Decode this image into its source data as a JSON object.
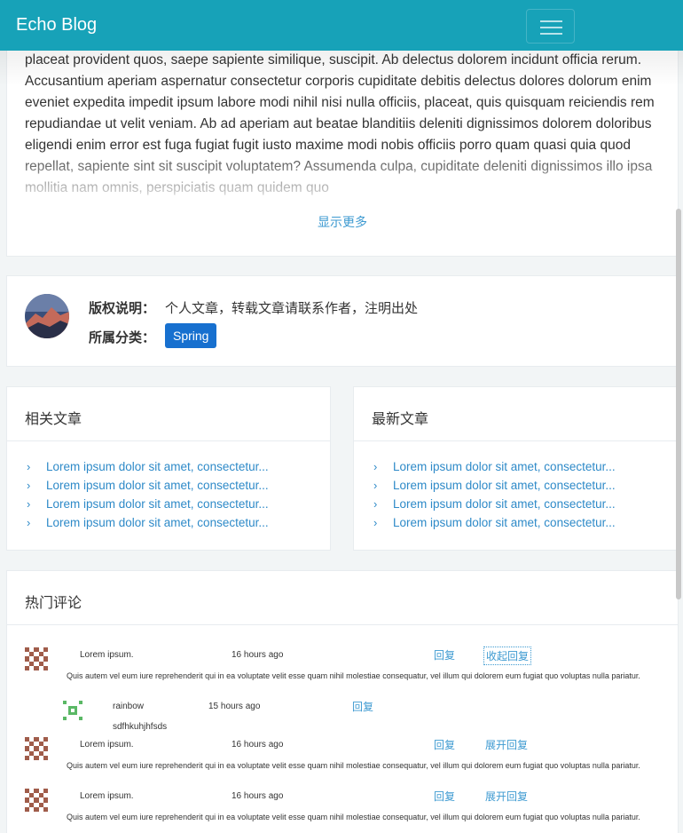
{
  "navbar": {
    "brand": "Echo Blog"
  },
  "article": {
    "text": "placeat provident quos, saepe sapiente similique, suscipit. Ab delectus dolorem incidunt officia rerum. Accusantium aperiam aspernatur consectetur corporis cupiditate debitis delectus dolores dolorum enim eveniet expedita impedit ipsum labore modi nihil nisi nulla officiis, placeat, quis quisquam reiciendis rem repudiandae ut velit veniam. Ab ad aperiam aut beatae blanditiis deleniti dignissimos dolorem doloribus eligendi enim error est fuga fugiat fugit iusto maxime modi nobis officiis porro quam quasi quia quod repellat, sapiente sint sit suscipit voluptatem? Assumenda culpa, cupiditate deleniti dignissimos illo ipsa mollitia nam omnis, perspiciatis quam quidem quo",
    "show_more": "显示更多"
  },
  "copyright": {
    "label": "版权说明：",
    "value": "个人文章，转载文章请联系作者，注明出处",
    "category_label": "所属分类：",
    "category": "Spring"
  },
  "related": {
    "title": "相关文章",
    "items": [
      "Lorem ipsum dolor sit amet, consectetur...",
      "Lorem ipsum dolor sit amet, consectetur...",
      "Lorem ipsum dolor sit amet, consectetur...",
      "Lorem ipsum dolor sit amet, consectetur..."
    ]
  },
  "latest": {
    "title": "最新文章",
    "items": [
      "Lorem ipsum dolor sit amet, consectetur...",
      "Lorem ipsum dolor sit amet, consectetur...",
      "Lorem ipsum dolor sit amet, consectetur...",
      "Lorem ipsum dolor sit amet, consectetur..."
    ]
  },
  "comments": {
    "title": "热门评论",
    "items": [
      {
        "user": "Lorem ipsum.",
        "time": "16 hours ago",
        "reply": "回复",
        "toggle": "收起回复",
        "body": "Quis autem vel eum iure reprehenderit qui in ea voluptate velit esse quam nihil molestiae consequatur, vel illum qui dolorem eum fugiat quo voluptas nulla pariatur.",
        "sub": {
          "user": "rainbow",
          "time": "15 hours ago",
          "reply": "回复",
          "body": "sdfhkuhjhfsds"
        }
      },
      {
        "user": "Lorem ipsum.",
        "time": "16 hours ago",
        "reply": "回复",
        "toggle": "展开回复",
        "body": "Quis autem vel eum iure reprehenderit qui in ea voluptate velit esse quam nihil molestiae consequatur, vel illum qui dolorem eum fugiat quo voluptas nulla pariatur."
      },
      {
        "user": "Lorem ipsum.",
        "time": "16 hours ago",
        "reply": "回复",
        "toggle": "展开回复",
        "body": "Quis autem vel eum iure reprehenderit qui in ea voluptate velit esse quam nihil molestiae consequatur, vel illum qui dolorem eum fugiat quo voluptas nulla pariatur."
      }
    ]
  },
  "colors": {
    "navbar": "#17a2b8",
    "link": "#2e8ac8",
    "tag": "#1770cf"
  }
}
